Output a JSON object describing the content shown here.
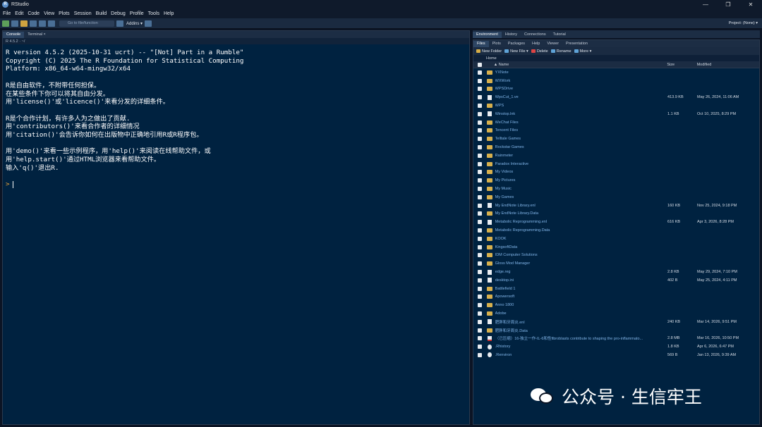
{
  "window": {
    "title": "RStudio",
    "controls": [
      "—",
      "❐",
      "✕"
    ]
  },
  "menu": [
    "File",
    "Edit",
    "Code",
    "View",
    "Plots",
    "Session",
    "Build",
    "Debug",
    "Profile",
    "Tools",
    "Help"
  ],
  "toolbar": {
    "goto_placeholder": "Go to file/function",
    "addins": "Addins ▾",
    "project": "Project: (None) ▾"
  },
  "left_tabs": [
    "Console",
    "Terminal ×"
  ],
  "console_bar": "R 4.5.2 · ~/",
  "console_lines": [
    "R version 4.5.2 (2025-10-31 ucrt) -- \"[Not] Part in a Rumble\"",
    "Copyright (C) 2025 The R Foundation for Statistical Computing",
    "Platform: x86_64-w64-mingw32/x64",
    "",
    "R是自由软件，不附带任何担保。",
    "在某些条件下你可以将其自由分发。",
    "用'license()'或'licence()'来看分发的详细条件。",
    "",
    "R是个合作计划，有许多人为之做出了贡献.",
    "用'contributors()'来看合作者的详细情况",
    "用'citation()'会告诉你如何在出版物中正确地引用R或R程序包。",
    "",
    "用'demo()'来看一些示例程序，用'help()'来阅读在线帮助文件，或",
    "用'help.start()'通过HTML浏览器来看帮助文件。",
    "输入'q()'退出R."
  ],
  "prompt": ">",
  "right_top_tabs": [
    "Environment",
    "History",
    "Connections",
    "Tutorial"
  ],
  "right_tabs": [
    "Files",
    "Plots",
    "Packages",
    "Help",
    "Viewer",
    "Presentation"
  ],
  "files_toolbar": [
    "New Folder",
    "New File ▾",
    "Delete",
    "Rename",
    "More ▾"
  ],
  "breadcrumb": "Home",
  "columns": {
    "name": "▲ Name",
    "size": "Size",
    "modified": "Modified"
  },
  "files": [
    {
      "type": "folder",
      "name": "YXNote",
      "size": "",
      "modified": ""
    },
    {
      "type": "folder",
      "name": "WXWork",
      "size": "",
      "modified": ""
    },
    {
      "type": "folder",
      "name": "WPSDrive",
      "size": "",
      "modified": ""
    },
    {
      "type": "file",
      "name": "WpsCut_1.ve",
      "size": "413.9 KB",
      "modified": "May 26, 2024, 11:06 AM"
    },
    {
      "type": "folder",
      "name": "WPS",
      "size": "",
      "modified": ""
    },
    {
      "type": "file",
      "name": "Winstop.lnk",
      "size": "1.1 KB",
      "modified": "Oct 10, 2025, 8:29 PM"
    },
    {
      "type": "folder",
      "name": "WeChat Files",
      "size": "",
      "modified": ""
    },
    {
      "type": "folder",
      "name": "Tencent Files",
      "size": "",
      "modified": ""
    },
    {
      "type": "folder",
      "name": "Telltale Games",
      "size": "",
      "modified": ""
    },
    {
      "type": "folder",
      "name": "Rockstar Games",
      "size": "",
      "modified": ""
    },
    {
      "type": "folder",
      "name": "Rainmeter",
      "size": "",
      "modified": ""
    },
    {
      "type": "folder",
      "name": "Paradox Interactive",
      "size": "",
      "modified": ""
    },
    {
      "type": "folder",
      "name": "My Videos",
      "size": "",
      "modified": ""
    },
    {
      "type": "folder",
      "name": "My Pictures",
      "size": "",
      "modified": ""
    },
    {
      "type": "folder",
      "name": "My Music",
      "size": "",
      "modified": ""
    },
    {
      "type": "folder",
      "name": "My Games",
      "size": "",
      "modified": ""
    },
    {
      "type": "file",
      "name": "My EndNote Library.enl",
      "size": "160 KB",
      "modified": "Nov 25, 2024, 9:18 PM"
    },
    {
      "type": "folder",
      "name": "My EndNote Library.Data",
      "size": "",
      "modified": ""
    },
    {
      "type": "file",
      "name": "Metabolic Reprogramming.enl",
      "size": "616 KB",
      "modified": "Apr 3, 2026, 8:28 PM"
    },
    {
      "type": "folder",
      "name": "Metabolic Reprogramming.Data",
      "size": "",
      "modified": ""
    },
    {
      "type": "folder",
      "name": "KOOK",
      "size": "",
      "modified": ""
    },
    {
      "type": "folder",
      "name": "KingsoftData",
      "size": "",
      "modified": ""
    },
    {
      "type": "folder",
      "name": "IDM Computer Solutions",
      "size": "",
      "modified": ""
    },
    {
      "type": "folder",
      "name": "Gloss Mod Manager",
      "size": "",
      "modified": ""
    },
    {
      "type": "file",
      "name": "edge.reg",
      "size": "2.8 KB",
      "modified": "May 29, 2024, 7:10 PM"
    },
    {
      "type": "file",
      "name": "desktop.ini",
      "size": "402 B",
      "modified": "May 25, 2024, 4:11 PM"
    },
    {
      "type": "folder",
      "name": "Battlefield 1",
      "size": "",
      "modified": ""
    },
    {
      "type": "folder",
      "name": "Apowersoft",
      "size": "",
      "modified": ""
    },
    {
      "type": "folder",
      "name": "Anno 1800",
      "size": "",
      "modified": ""
    },
    {
      "type": "folder",
      "name": "Adobe",
      "size": "",
      "modified": ""
    },
    {
      "type": "file",
      "name": "肥胖和牙周炎.enl",
      "size": "240 KB",
      "modified": "Mar 14, 2026, 9:51 PM"
    },
    {
      "type": "folder",
      "name": "肥胖和牙周炎.Data",
      "size": "",
      "modified": ""
    },
    {
      "type": "pdf",
      "name": "（已压缩）16-独立一作-IL-6和性fibroblasts contribute to shaping the pro-inflammato...",
      "size": "2.8 MB",
      "modified": "Mar 16, 2026, 10:50 PM"
    },
    {
      "type": "r",
      "name": ".Rhistory",
      "size": "1.8 KB",
      "modified": "Apr 6, 2026, 6:47 PM"
    },
    {
      "type": "r",
      "name": ".Renviron",
      "size": "569 B",
      "modified": "Jan 13, 2026, 9:39 AM"
    }
  ],
  "watermark": "公众号 · 生信牢王"
}
